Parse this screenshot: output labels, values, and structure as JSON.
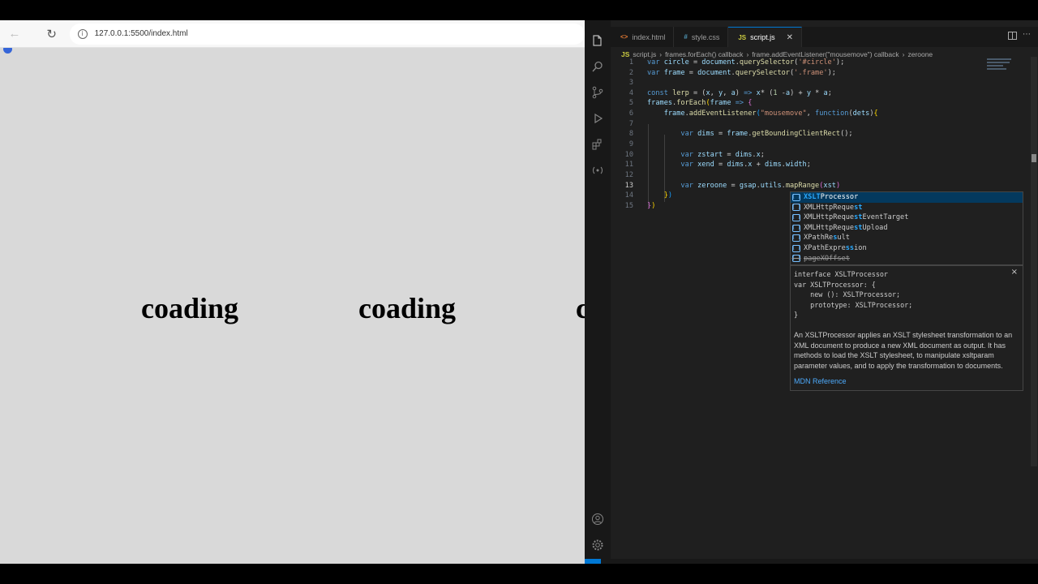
{
  "browser": {
    "back_icon": "arrow-left-icon",
    "reload_icon": "reload-icon",
    "url": "127.0.0.1:5500/index.html",
    "frames": [
      "coading",
      "coading",
      "c"
    ]
  },
  "vscode": {
    "tabs": [
      {
        "icon": "<>",
        "label": "index.html"
      },
      {
        "icon": "#",
        "label": "style.css"
      },
      {
        "icon": "JS",
        "label": "script.js"
      }
    ],
    "close_glyph": "✕",
    "breadcrumb": {
      "file_icon": "JS",
      "file": "script.js",
      "items": [
        "frames.forEach() callback",
        "frame.addEventListener(\"mousemove\") callback",
        "zeroone"
      ]
    },
    "line_numbers": [
      "1",
      "2",
      "3",
      "4",
      "5",
      "6",
      "7",
      "8",
      "9",
      "10",
      "11",
      "12",
      "13",
      "14",
      "15"
    ],
    "current_line": "13",
    "suggestions": {
      "selected": {
        "prefix": "XSLT",
        "rest": "Processor"
      },
      "items": [
        {
          "a": "XMLHttpReque",
          "b": "st",
          "c": ""
        },
        {
          "a": "XMLHttpReque",
          "b": "st",
          "c": "EventTarget"
        },
        {
          "a": "XMLHttpReque",
          "b": "st",
          "c": "Upload"
        },
        {
          "a": "XPathRe",
          "b": "s",
          "c": "ult"
        },
        {
          "a": "XPathExpre",
          "b": "ss",
          "c": "ion"
        }
      ],
      "deprecated": "pageXOffset"
    },
    "docs": {
      "signature": "interface XSLTProcessor\nvar XSLTProcessor: {\n    new (): XSLTProcessor;\n    prototype: XSLTProcessor;\n}",
      "description": "An XSLTProcessor applies an XSLT stylesheet transformation to an XML document to produce a new XML document as output. It has methods to load the XSLT stylesheet, to manipulate xsltparam parameter values, and to apply the transformation to documents.",
      "link": "MDN Reference",
      "close": "×"
    }
  },
  "colors": {
    "editor_bg": "#1f1f1f",
    "keyword": "#569cd6",
    "variable": "#9cdcfe",
    "function": "#dcdcaa",
    "string": "#ce9178",
    "accent": "#0078d4",
    "browser_cursor_circle": "#3565d8"
  }
}
